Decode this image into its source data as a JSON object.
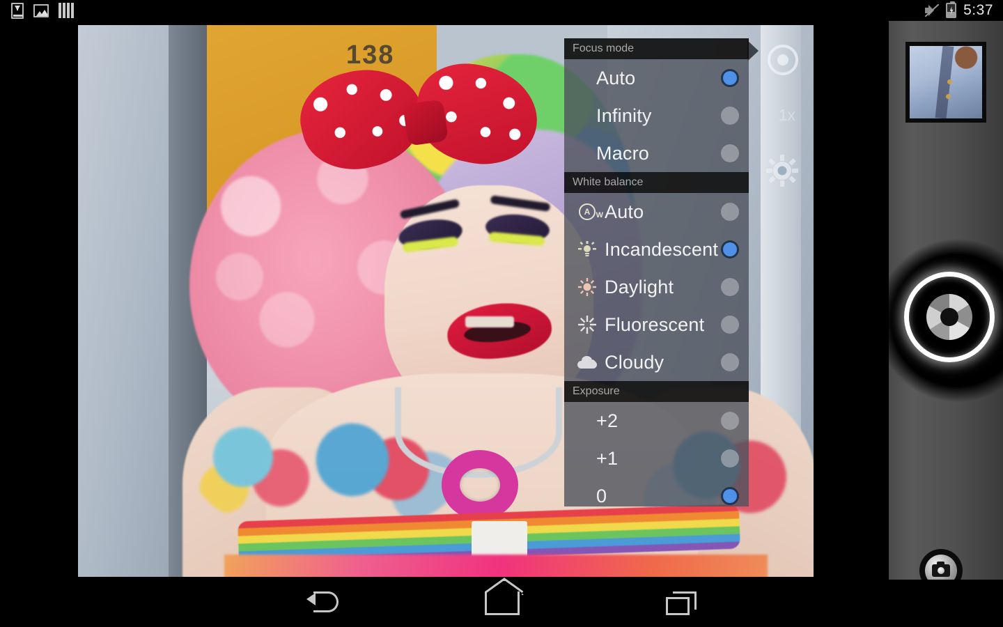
{
  "status_bar": {
    "left_icons": [
      {
        "name": "download-icon",
        "label": "Download"
      },
      {
        "name": "picture-icon",
        "label": "Screenshot captured"
      },
      {
        "name": "film-strip-icon",
        "label": "Media"
      }
    ],
    "right_icons": [
      {
        "name": "mute-icon",
        "label": "Sound muted"
      },
      {
        "name": "battery-charging-icon",
        "label": "Battery charging"
      }
    ],
    "time": "5:37"
  },
  "preview": {
    "house_number": "138",
    "zoom_level": "1x",
    "controls": [
      {
        "name": "scene-mode-icon",
        "label": "Scene mode"
      },
      {
        "name": "zoom-indicator",
        "label": "1x"
      },
      {
        "name": "settings-gear-icon",
        "label": "Settings"
      }
    ]
  },
  "settings_popup": {
    "pointer": true,
    "sections": [
      {
        "header": "Focus mode",
        "options": [
          {
            "label": "Auto",
            "icon": "",
            "selected": true
          },
          {
            "label": "Infinity",
            "icon": "",
            "selected": false
          },
          {
            "label": "Macro",
            "icon": "",
            "selected": false
          }
        ]
      },
      {
        "header": "White balance",
        "options": [
          {
            "label": "Auto",
            "icon": "auto-white-balance-icon",
            "selected": false
          },
          {
            "label": "Incandescent",
            "icon": "incandescent-bulb-icon",
            "selected": true
          },
          {
            "label": "Daylight",
            "icon": "sun-icon",
            "selected": false
          },
          {
            "label": "Fluorescent",
            "icon": "fluorescent-icon",
            "selected": false
          },
          {
            "label": "Cloudy",
            "icon": "cloud-icon",
            "selected": false
          }
        ]
      },
      {
        "header": "Exposure",
        "options": [
          {
            "label": "+2",
            "icon": "",
            "selected": false
          },
          {
            "label": "+1",
            "icon": "",
            "selected": false
          },
          {
            "label": "0",
            "icon": "",
            "selected": true
          }
        ]
      }
    ]
  },
  "right_panel": {
    "thumbnail_label": "Last photo thumbnail",
    "shutter_label": "Shutter",
    "mode_label": "Camera mode"
  },
  "nav_bar": {
    "items": [
      {
        "name": "nav-back-button",
        "label": "Back"
      },
      {
        "name": "nav-home-button",
        "label": "Home"
      },
      {
        "name": "nav-recents-button",
        "label": "Recent apps"
      }
    ]
  },
  "colors": {
    "accent_selected": "#4f90e8",
    "panel_bg": "#4e525c",
    "header_bg": "#0e0e0e",
    "text_primary": "#f2f2f2",
    "text_header": "#a9a9a9"
  }
}
